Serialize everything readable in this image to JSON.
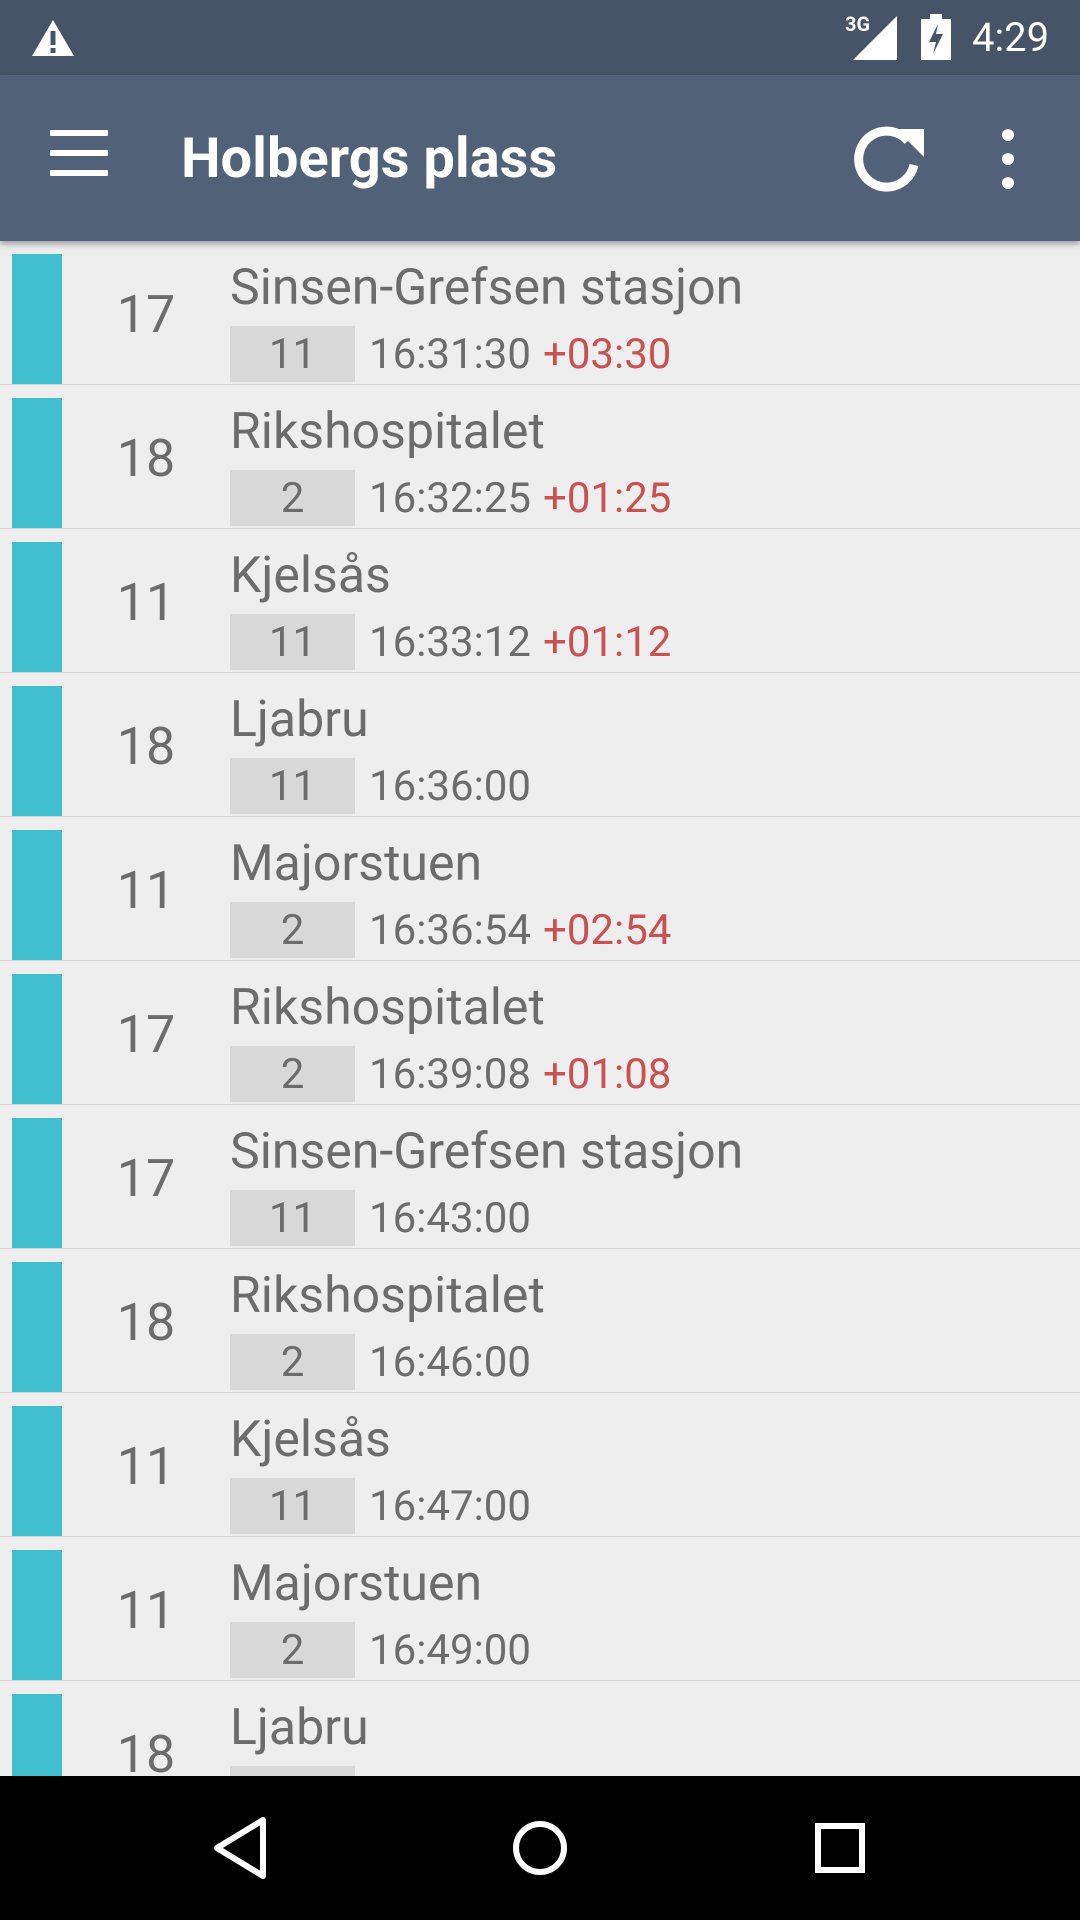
{
  "status_bar": {
    "network": "3G",
    "time": "4:29",
    "icons": [
      "warning-icon",
      "signal-icon",
      "battery-charging-icon"
    ]
  },
  "app_bar": {
    "title": "Holbergs plass",
    "icons": [
      "menu-icon",
      "refresh-icon",
      "more-vert-icon"
    ]
  },
  "colors": {
    "status_bar": "#465467",
    "app_bar": "#516177",
    "line_marker": "#41bfcf",
    "delay": "#c9514f",
    "platform_bg": "#d8d8d8",
    "list_bg": "#eeeeee"
  },
  "departures": [
    {
      "line": "17",
      "destination": "Sinsen-Grefsen stasjon",
      "platform": "11",
      "time": "16:31:30",
      "delay": "+03:30"
    },
    {
      "line": "18",
      "destination": "Rikshospitalet",
      "platform": "2",
      "time": "16:32:25",
      "delay": "+01:25"
    },
    {
      "line": "11",
      "destination": "Kjelsås",
      "platform": "11",
      "time": "16:33:12",
      "delay": "+01:12"
    },
    {
      "line": "18",
      "destination": "Ljabru",
      "platform": "11",
      "time": "16:36:00",
      "delay": ""
    },
    {
      "line": "11",
      "destination": "Majorstuen",
      "platform": "2",
      "time": "16:36:54",
      "delay": "+02:54"
    },
    {
      "line": "17",
      "destination": "Rikshospitalet",
      "platform": "2",
      "time": "16:39:08",
      "delay": "+01:08"
    },
    {
      "line": "17",
      "destination": "Sinsen-Grefsen stasjon",
      "platform": "11",
      "time": "16:43:00",
      "delay": ""
    },
    {
      "line": "18",
      "destination": "Rikshospitalet",
      "platform": "2",
      "time": "16:46:00",
      "delay": ""
    },
    {
      "line": "11",
      "destination": "Kjelsås",
      "platform": "11",
      "time": "16:47:00",
      "delay": ""
    },
    {
      "line": "11",
      "destination": "Majorstuen",
      "platform": "2",
      "time": "16:49:00",
      "delay": ""
    },
    {
      "line": "18",
      "destination": "Ljabru",
      "platform": "",
      "time": "",
      "delay": ""
    }
  ],
  "nav_bar": {
    "icons": [
      "back-icon",
      "home-icon",
      "recents-icon"
    ]
  }
}
